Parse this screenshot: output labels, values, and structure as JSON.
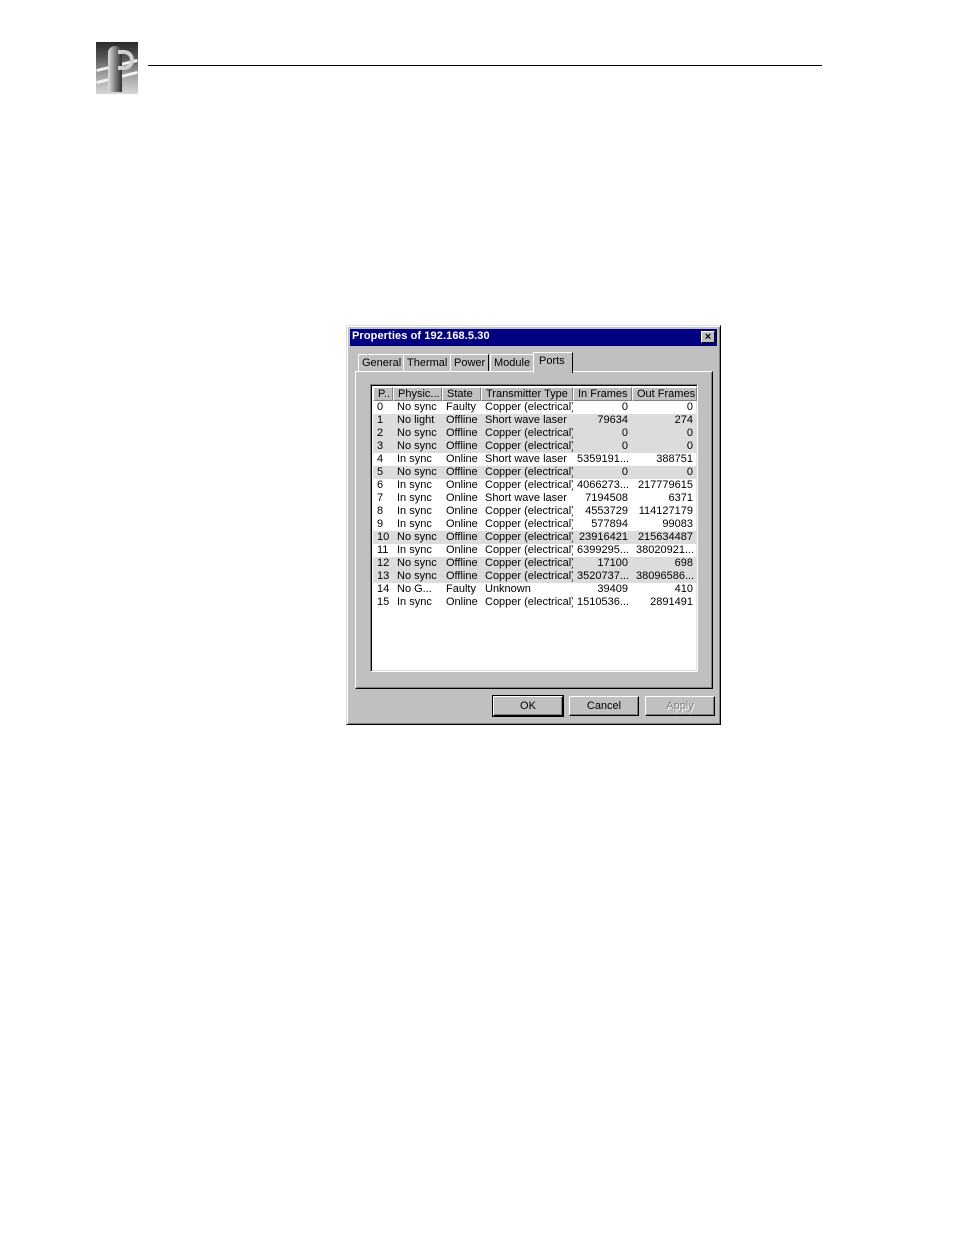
{
  "dialog": {
    "title": "Properties of 192.168.5.30",
    "close_label": "×",
    "tabs": [
      {
        "label": "General",
        "active": false
      },
      {
        "label": "Thermal",
        "active": false
      },
      {
        "label": "Power",
        "active": false
      },
      {
        "label": "Module",
        "active": false
      },
      {
        "label": "Ports",
        "active": true
      }
    ],
    "ports_table": {
      "columns": [
        "P..",
        "Physic...",
        "State",
        "Transmitter Type",
        "In Frames",
        "Out Frames"
      ],
      "rows": [
        {
          "port": "0",
          "physical": "No sync",
          "state": "Faulty",
          "transmitter": "Copper (electrical)",
          "in_frames": "0",
          "out_frames": "0",
          "highlighted": false
        },
        {
          "port": "1",
          "physical": "No light",
          "state": "Offline",
          "transmitter": "Short wave laser",
          "in_frames": "79634",
          "out_frames": "274",
          "highlighted": true
        },
        {
          "port": "2",
          "physical": "No sync",
          "state": "Offline",
          "transmitter": "Copper (electrical)",
          "in_frames": "0",
          "out_frames": "0",
          "highlighted": true
        },
        {
          "port": "3",
          "physical": "No sync",
          "state": "Offline",
          "transmitter": "Copper (electrical)",
          "in_frames": "0",
          "out_frames": "0",
          "highlighted": true
        },
        {
          "port": "4",
          "physical": "In sync",
          "state": "Online",
          "transmitter": "Short wave laser",
          "in_frames": "5359191...",
          "out_frames": "388751",
          "highlighted": false
        },
        {
          "port": "5",
          "physical": "No sync",
          "state": "Offline",
          "transmitter": "Copper (electrical)",
          "in_frames": "0",
          "out_frames": "0",
          "highlighted": true
        },
        {
          "port": "6",
          "physical": "In sync",
          "state": "Online",
          "transmitter": "Copper (electrical)",
          "in_frames": "4066273...",
          "out_frames": "217779615",
          "highlighted": false
        },
        {
          "port": "7",
          "physical": "In sync",
          "state": "Online",
          "transmitter": "Short wave laser",
          "in_frames": "7194508",
          "out_frames": "6371",
          "highlighted": false
        },
        {
          "port": "8",
          "physical": "In sync",
          "state": "Online",
          "transmitter": "Copper (electrical)",
          "in_frames": "4553729",
          "out_frames": "114127179",
          "highlighted": false
        },
        {
          "port": "9",
          "physical": "In sync",
          "state": "Online",
          "transmitter": "Copper (electrical)",
          "in_frames": "577894",
          "out_frames": "99083",
          "highlighted": false
        },
        {
          "port": "10",
          "physical": "No sync",
          "state": "Offline",
          "transmitter": "Copper (electrical)",
          "in_frames": "23916421",
          "out_frames": "215634487",
          "highlighted": true
        },
        {
          "port": "11",
          "physical": "In sync",
          "state": "Online",
          "transmitter": "Copper (electrical)",
          "in_frames": "6399295...",
          "out_frames": "38020921...",
          "highlighted": false
        },
        {
          "port": "12",
          "physical": "No sync",
          "state": "Offline",
          "transmitter": "Copper (electrical)",
          "in_frames": "17100",
          "out_frames": "698",
          "highlighted": true
        },
        {
          "port": "13",
          "physical": "No sync",
          "state": "Offline",
          "transmitter": "Copper (electrical)",
          "in_frames": "3520737...",
          "out_frames": "38096586...",
          "highlighted": true
        },
        {
          "port": "14",
          "physical": "No G...",
          "state": "Faulty",
          "transmitter": "Unknown",
          "in_frames": "39409",
          "out_frames": "410",
          "highlighted": false
        },
        {
          "port": "15",
          "physical": "In sync",
          "state": "Online",
          "transmitter": "Copper (electrical)",
          "in_frames": "1510536...",
          "out_frames": "2891491",
          "highlighted": false
        }
      ]
    },
    "buttons": {
      "ok": "OK",
      "cancel": "Cancel",
      "apply": "Apply"
    }
  },
  "colors": {
    "titlebar": "#000080",
    "dialog_face": "#c0c0c0",
    "row_highlight": "#dcdcdc"
  }
}
